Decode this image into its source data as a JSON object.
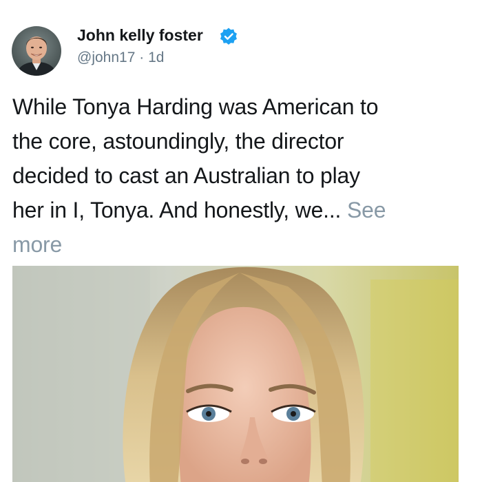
{
  "tweet": {
    "author": {
      "display_name": "John kelly foster",
      "verified_icon": "verified-badge-icon",
      "handle": "@john17",
      "separator": "·",
      "time": "1d"
    },
    "text_lines": [
      "While Tonya Harding was American to",
      "the core, astoundingly, the director",
      "decided to cast an Australian to play",
      "her in I, Tonya. And honestly, we..."
    ],
    "see_more_label": "See",
    "see_more_label_2": "more",
    "media": {
      "type": "photo"
    }
  },
  "colors": {
    "text_primary": "#14171a",
    "text_secondary": "#657786",
    "link_muted": "#8899a6",
    "verified_blue": "#1da1f2"
  }
}
